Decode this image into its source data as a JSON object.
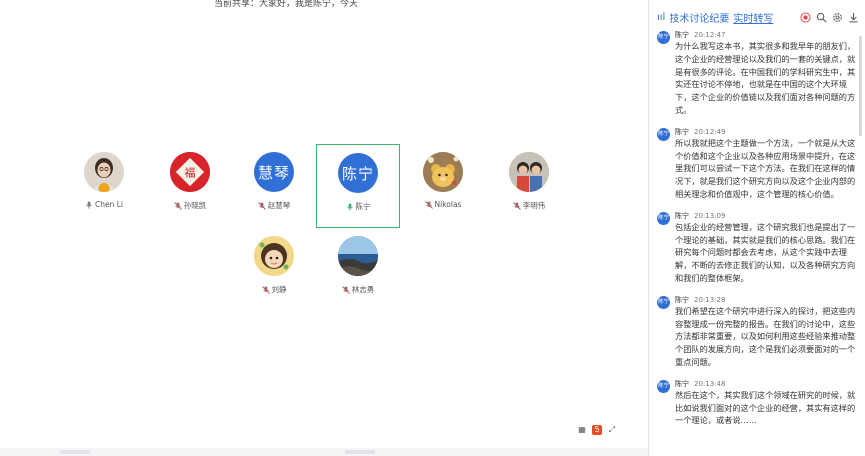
{
  "stage": {
    "top_fragment": "当前共享：大家好，我是陈宁，今天",
    "participants_row1": [
      {
        "name": "Chen Li",
        "avatar": "photo-woman",
        "host": true
      },
      {
        "name": "孙晓凯",
        "avatar": "red-fu"
      },
      {
        "name": "赵慧琴",
        "avatar": "text",
        "avatar_text": "慧琴"
      },
      {
        "name": "陈宁",
        "avatar": "text",
        "avatar_text": "陈宁",
        "active": true
      },
      {
        "name": "Nikolas",
        "avatar": "photo-bear"
      },
      {
        "name": "李明伟",
        "avatar": "photo-kids"
      }
    ],
    "participants_row2": [
      {
        "name": "刘静",
        "avatar": "cartoon-girl"
      },
      {
        "name": "林志勇",
        "avatar": "photo-sea"
      }
    ],
    "bottom_icons": [
      "grid-icon",
      "html5-icon",
      "expand-icon"
    ]
  },
  "panel": {
    "title": "技术讨论纪要",
    "title_link": "实时转写",
    "header_buttons": [
      "record-icon",
      "search-icon",
      "settings-icon",
      "download-icon"
    ],
    "messages": [
      {
        "speaker": "陈宁",
        "avatar_text": "陈宁",
        "time": "20:12:47",
        "text": "为什么我写这本书，其实很多和我早年的朋友们，这个企业的经营理论以及我们的一套的关键点，就是有很多的评论。在中国我们的学科研究生中，其实还在讨论不停地，也就是在中国的这个大环境下，这个企业的价值链以及我们面对各种问题的方式。"
      },
      {
        "speaker": "陈宁",
        "avatar_text": "陈宁",
        "time": "20:12:49",
        "text": "所以我就把这个主题做一个方法，一个就是从大这个价值和这个企业以及各种应用场景中提升，在这里我们可以尝试一下这个方法。在我们在这样的情况下，就是我们这个研究方向以及这个企业内部的相关理念和价值观中，这个管理的核心价值。"
      },
      {
        "speaker": "陈宁",
        "avatar_text": "陈宁",
        "time": "20:13:09",
        "text": "包括企业的经营管理，这个研究我们也是提出了一个理论的基础，其实就是我们的核心思路。我们在研究每个问题时都会去考虑，从这个实践中去理解，不断的去修正我们的认知，以及各种研究方向和我们的整体框架。"
      },
      {
        "speaker": "陈宁",
        "avatar_text": "陈宁",
        "time": "20:13:28",
        "text": "我们希望在这个研究中进行深入的探讨，把这些内容整理成一份完整的报告。在我们的讨论中，这些方法都非常重要，以及如何利用这些经验来推动整个团队的发展方向，这个是我们必须要面对的一个重点问题。"
      },
      {
        "speaker": "陈宁",
        "avatar_text": "陈宁",
        "time": "20:13:48",
        "text": "然后在这个，其实我们这个领域在研究的时候，就比如说我们面对的这个企业的经营，其实有这样的一个理论，或者说……"
      }
    ]
  },
  "colors": {
    "accent": "#2f6fd6",
    "active_border": "#3fb36c",
    "host_badge": "#f0a51e"
  }
}
